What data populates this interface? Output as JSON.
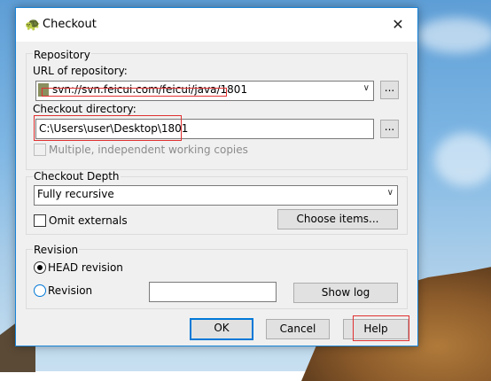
{
  "window": {
    "title": "Checkout",
    "close_glyph": "✕"
  },
  "repository": {
    "group_label": "Repository",
    "url_label": "URL of repository:",
    "url_value": "svn://svn.feicui.com/feicui/java/1801",
    "browse_label": "...",
    "dir_label": "Checkout directory:",
    "dir_value": "C:\\Users\\user\\Desktop\\1801",
    "dir_browse_label": "...",
    "multiple_label": "Multiple, independent working copies",
    "multiple_checked": false,
    "multiple_enabled": false
  },
  "depth": {
    "group_label": "Checkout Depth",
    "selected": "Fully recursive",
    "omit_label": "Omit externals",
    "omit_checked": false,
    "choose_label": "Choose items..."
  },
  "revision": {
    "group_label": "Revision",
    "head_label": "HEAD revision",
    "head_selected": true,
    "rev_label": "Revision",
    "rev_value": "",
    "show_log_label": "Show log"
  },
  "buttons": {
    "ok": "OK",
    "cancel": "Cancel",
    "help": "Help"
  },
  "colors": {
    "accent": "#0078d7",
    "highlight_box": "#e03030"
  }
}
